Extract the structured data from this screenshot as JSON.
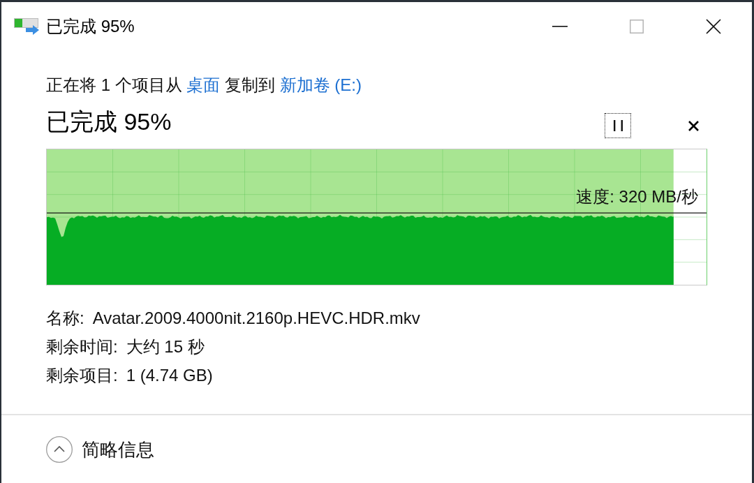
{
  "window": {
    "title": "已完成 95%",
    "controls": [
      {
        "kind": "minimize",
        "disabled": false
      },
      {
        "kind": "maximize",
        "disabled": true
      },
      {
        "kind": "close",
        "disabled": false
      }
    ]
  },
  "description": [
    {
      "kind": "text",
      "text": "正在将 1 个项目从 "
    },
    {
      "kind": "link",
      "text": "桌面"
    },
    {
      "kind": "text",
      "text": " 复制到 "
    },
    {
      "kind": "link",
      "text": "新加卷 (E:)"
    }
  ],
  "progress": {
    "heading": "已完成 95%",
    "buttons": [
      {
        "kind": "pause",
        "focused": true
      },
      {
        "kind": "cancel",
        "focused": false
      }
    ]
  },
  "graph": {
    "level": 0.95,
    "speed": "速度: 320 MB/秒"
  },
  "details": [
    {
      "label": "名称:",
      "value": "Avatar.2009.4000nit.2160p.HEVC.HDR.mkv"
    },
    {
      "label": "剩余时间:",
      "value": "大约 15 秒"
    },
    {
      "label": "剩余项目:",
      "value": "1 (4.74 GB)"
    }
  ],
  "footer": {
    "label": "简略信息",
    "expanded": true
  }
}
